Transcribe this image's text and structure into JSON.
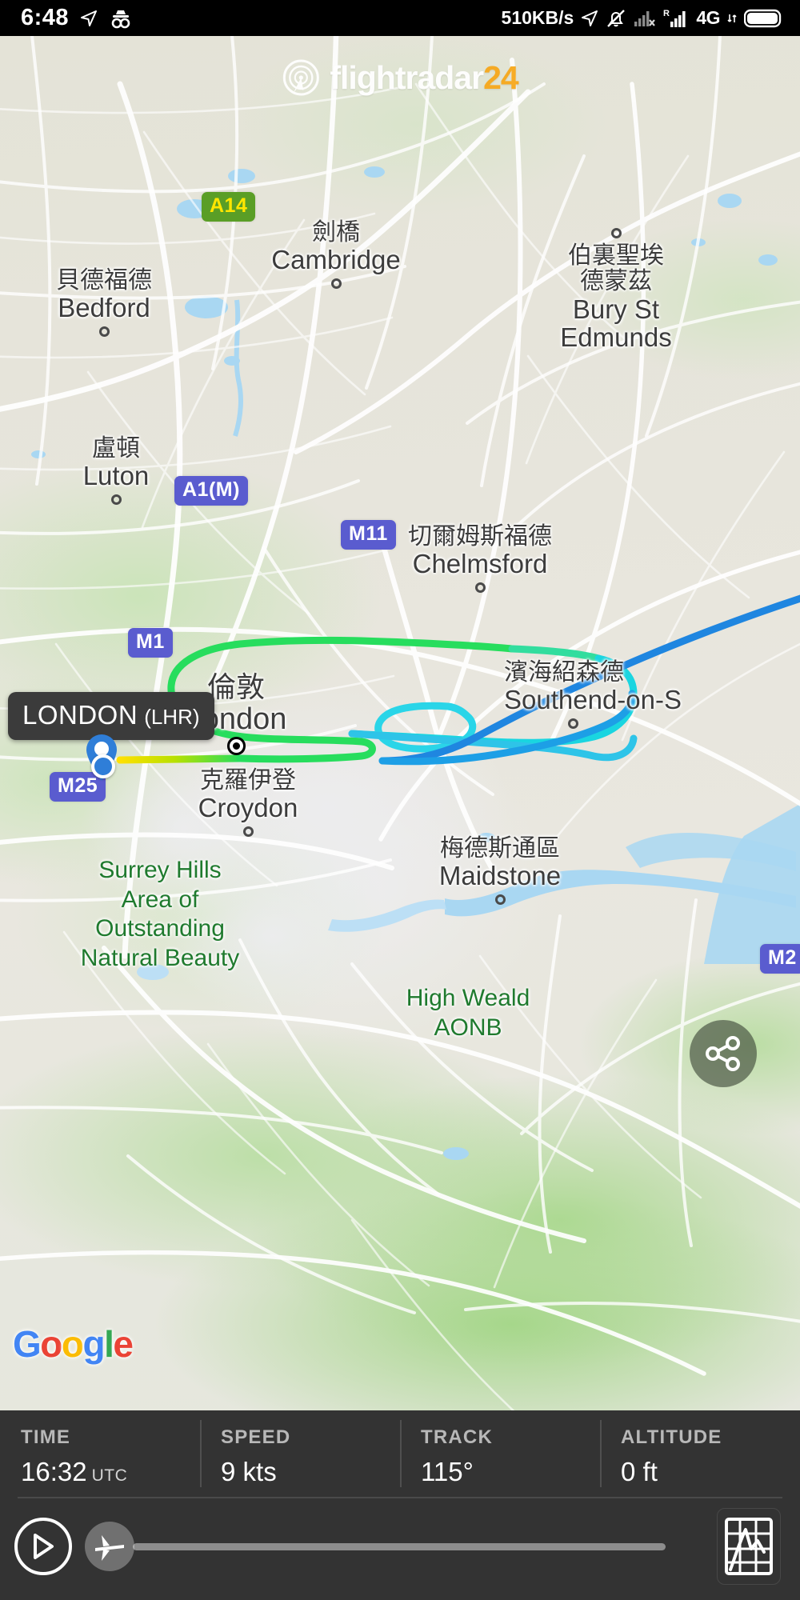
{
  "status_bar": {
    "time": "6:48",
    "network_speed": "510KB/s",
    "network_type": "4G",
    "icons": [
      "location-arrow-icon",
      "incognito-icon",
      "location-arrow-icon",
      "bell-muted-icon",
      "signal-no-service-icon",
      "roaming-signal-icon",
      "battery-icon"
    ]
  },
  "brand": {
    "name": "flightradar",
    "suffix": "24",
    "accent_color": "#f7a81b"
  },
  "map": {
    "attribution": "Google",
    "places": [
      {
        "cn": "劍橋",
        "en": "Cambridge"
      },
      {
        "cn": "貝德福德",
        "en": "Bedford"
      },
      {
        "cn": "伯裏聖埃",
        "cn2": "德蒙茲",
        "en": "Bury St",
        "en2": "Edmunds"
      },
      {
        "cn": "盧頓",
        "en": "Luton"
      },
      {
        "cn": "切爾姆斯福德",
        "en": "Chelmsford"
      },
      {
        "cn": "倫敦",
        "en": "London"
      },
      {
        "cn": "濱海紹森德",
        "en": "Southend-on-S"
      },
      {
        "cn": "克羅伊登",
        "en": "Croydon"
      },
      {
        "cn": "梅德斯通區",
        "en": "Maidstone"
      }
    ],
    "parks": [
      {
        "lines": [
          "Surrey Hills",
          "Area of",
          "Outstanding",
          "Natural Beauty"
        ]
      },
      {
        "lines": [
          "High Weald",
          "AONB"
        ]
      }
    ],
    "shields": [
      {
        "label": "A14",
        "style": "green"
      },
      {
        "label": "A1(M)",
        "style": "purple"
      },
      {
        "label": "M11",
        "style": "purple"
      },
      {
        "label": "M1",
        "style": "purple"
      },
      {
        "label": "M25",
        "style": "purple"
      },
      {
        "label": "M2",
        "style": "purple"
      }
    ],
    "airport_marker": {
      "city": "LONDON",
      "code": "(LHR)"
    },
    "share_label": "share-icon"
  },
  "flight_info": {
    "stats": [
      {
        "key": "TIME",
        "value": "16:32",
        "unit": "UTC"
      },
      {
        "key": "SPEED",
        "value": "9 kts",
        "unit": ""
      },
      {
        "key": "TRACK",
        "value": "115°",
        "unit": ""
      },
      {
        "key": "ALTITUDE",
        "value": "0 ft",
        "unit": ""
      }
    ]
  },
  "playback": {
    "play_label": "play-icon",
    "handle_label": "airplane-handle",
    "graph_label": "altitude-graph-icon"
  }
}
